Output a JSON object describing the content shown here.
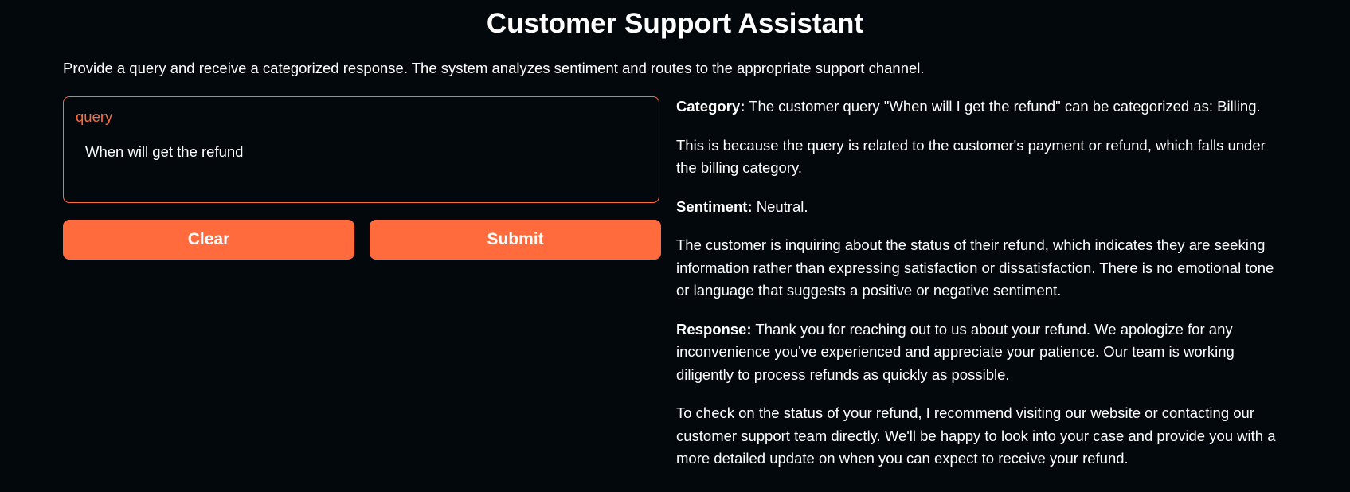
{
  "header": {
    "title": "Customer Support Assistant",
    "description": "Provide a query and receive a categorized response. The system analyzes sentiment and routes to the appropriate support channel."
  },
  "input": {
    "label": "query",
    "value": "When will get the refund"
  },
  "buttons": {
    "clear_label": "Clear",
    "submit_label": "Submit"
  },
  "output": {
    "category_label": "Category:",
    "category_text": " The customer query \"When will I get the refund\" can be categorized as: Billing.",
    "category_reason": "This is because the query is related to the customer's payment or refund, which falls under the billing category.",
    "sentiment_label": "Sentiment:",
    "sentiment_text": " Neutral.",
    "sentiment_reason": "The customer is inquiring about the status of their refund, which indicates they are seeking information rather than expressing satisfaction or dissatisfaction. There is no emotional tone or language that suggests a positive or negative sentiment.",
    "response_label": "Response:",
    "response_text": " Thank you for reaching out to us about your refund. We apologize for any inconvenience you've experienced and appreciate your patience. Our team is working diligently to process refunds as quickly as possible.",
    "response_followup": "To check on the status of your refund, I recommend visiting our website or contacting our customer support team directly. We'll be happy to look into your case and provide you with a more detailed update on when you can expect to receive your refund."
  },
  "colors": {
    "background": "#03080d",
    "accent": "#ff6b3d",
    "text": "#ffffff"
  }
}
